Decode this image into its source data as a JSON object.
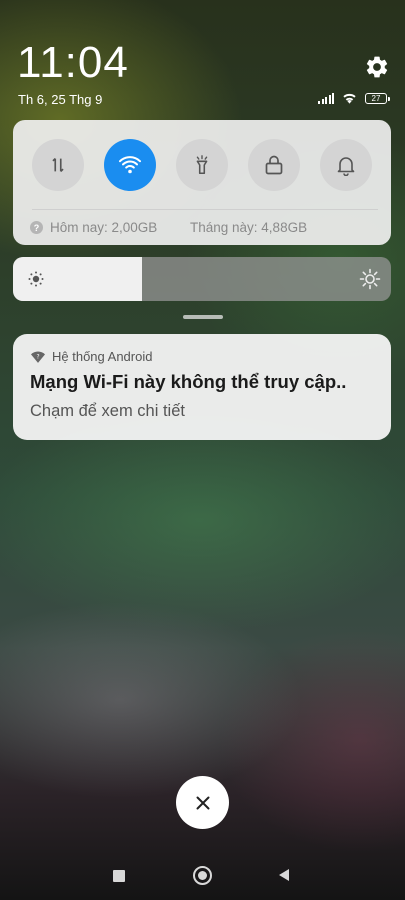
{
  "status": {
    "time": "11:04",
    "date": "Th 6, 25 Thg 9",
    "battery_level": "27"
  },
  "quick_toggles": {
    "items": [
      {
        "name": "mobile-data",
        "icon": "data-transfer-icon",
        "active": false
      },
      {
        "name": "wifi",
        "icon": "wifi-icon",
        "active": true
      },
      {
        "name": "flashlight",
        "icon": "flashlight-icon",
        "active": false
      },
      {
        "name": "lock-screen",
        "icon": "lock-icon",
        "active": false
      },
      {
        "name": "silent",
        "icon": "bell-icon",
        "active": false
      }
    ],
    "data_today": "Hôm nay: 2,00GB",
    "data_month": "Tháng này: 4,88GB"
  },
  "brightness": {
    "level_fraction": 0.34
  },
  "notification": {
    "app_name": "Hệ thống Android",
    "title": "Mạng Wi-Fi này không thể truy cập..",
    "text": "Chạm để xem chi tiết"
  },
  "colors": {
    "accent": "#1a8df0",
    "panel": "#f0f0f0",
    "toggle_off": "#d4d4d4"
  }
}
